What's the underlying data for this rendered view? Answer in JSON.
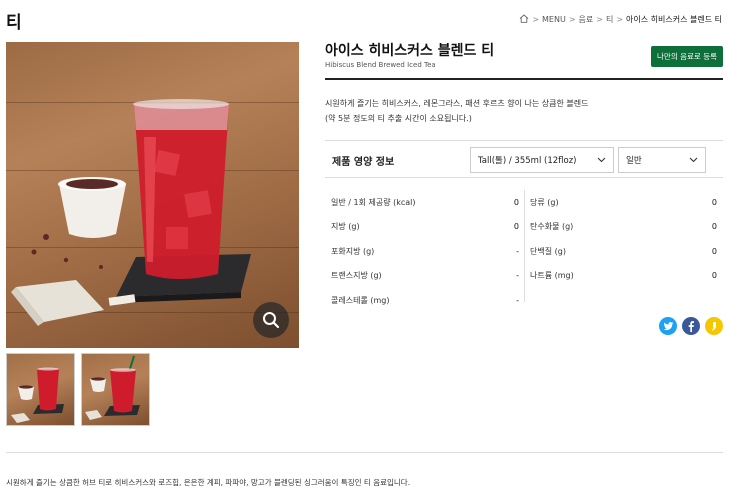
{
  "page": {
    "title": "티"
  },
  "breadcrumb": {
    "items": [
      "MENU",
      "음료",
      "티"
    ],
    "current": "아이스 히비스커스 블렌드 티"
  },
  "product": {
    "name_ko": "아이스 히비스커스 블렌드 티",
    "name_en": "Hibiscus Blend Brewed Iced Tea",
    "add_button": "나만의 음료로 등록",
    "description_line1": "시원하게 즐기는 히비스커스, 레몬그라스, 패션 후르츠 향이 나는 상큼한 블렌드",
    "description_line2": "(약 5분 정도의 티 추출 시간이 소요됩니다.)"
  },
  "nutrition": {
    "title": "제품 영양 정보",
    "size_option": "Tall(톨) / 355ml (12floz)",
    "milk_option": "일반",
    "left": [
      {
        "label": "일반 / 1회 제공량 (kcal)",
        "value": "0"
      },
      {
        "label": "지방 (g)",
        "value": "0"
      },
      {
        "label": "포화지방 (g)",
        "value": "-"
      },
      {
        "label": "트랜스지방 (g)",
        "value": "-"
      },
      {
        "label": "콜레스테롤 (mg)",
        "value": "-"
      }
    ],
    "right": [
      {
        "label": "당류 (g)",
        "value": "0"
      },
      {
        "label": "탄수화물 (g)",
        "value": "0"
      },
      {
        "label": "단백질 (g)",
        "value": "0"
      },
      {
        "label": "나트륨 (mg)",
        "value": "0"
      }
    ]
  },
  "share": {
    "icons": [
      "twitter-icon",
      "facebook-icon",
      "kakaostory-icon"
    ],
    "colors": {
      "twitter": "#1da1f2",
      "facebook": "#3b5998",
      "kakao": "#f6c700"
    }
  },
  "footer": {
    "description": "시원하게 즐기는 상큼한 허브 티로 히비스커스와 로즈힙, 은은한 계피, 파파야, 망고가 블렌딩된 싱그러움이 특징인 티 음료입니다."
  },
  "colors": {
    "accent": "#0f6f3a",
    "drink": "#d81f2e"
  }
}
